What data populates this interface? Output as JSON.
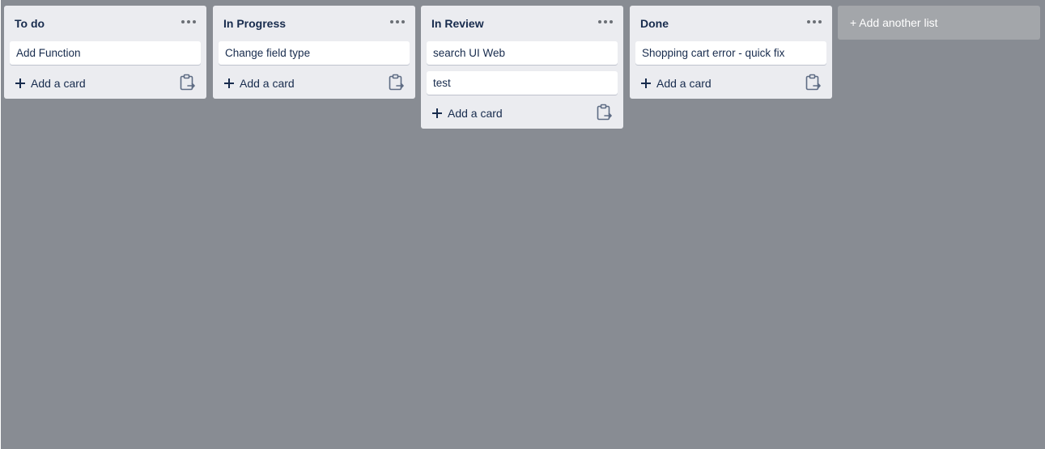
{
  "board": {
    "lists": [
      {
        "title": "To do",
        "menu_icon": "more-horizontal-icon",
        "cards": [
          "Add Function"
        ],
        "add_card_label": "Add a card",
        "template_icon": "create-from-template-icon"
      },
      {
        "title": "In Progress",
        "menu_icon": "more-horizontal-icon",
        "cards": [
          "Change field type"
        ],
        "add_card_label": "Add a card",
        "template_icon": "create-from-template-icon"
      },
      {
        "title": "In Review",
        "menu_icon": "more-horizontal-icon",
        "cards": [
          "search UI Web",
          "test"
        ],
        "add_card_label": "Add a card",
        "template_icon": "create-from-template-icon"
      },
      {
        "title": "Done",
        "menu_icon": "more-horizontal-icon",
        "cards": [
          "Shopping cart error - quick fix"
        ],
        "add_card_label": "Add a card",
        "template_icon": "create-from-template-icon"
      }
    ],
    "add_list_label": "+ Add another list"
  },
  "colors": {
    "board_background": "#888c93",
    "list_background": "#ebecf0",
    "card_background": "#ffffff",
    "text": "#172b4d",
    "add_list_background": "#a3a6aa"
  }
}
